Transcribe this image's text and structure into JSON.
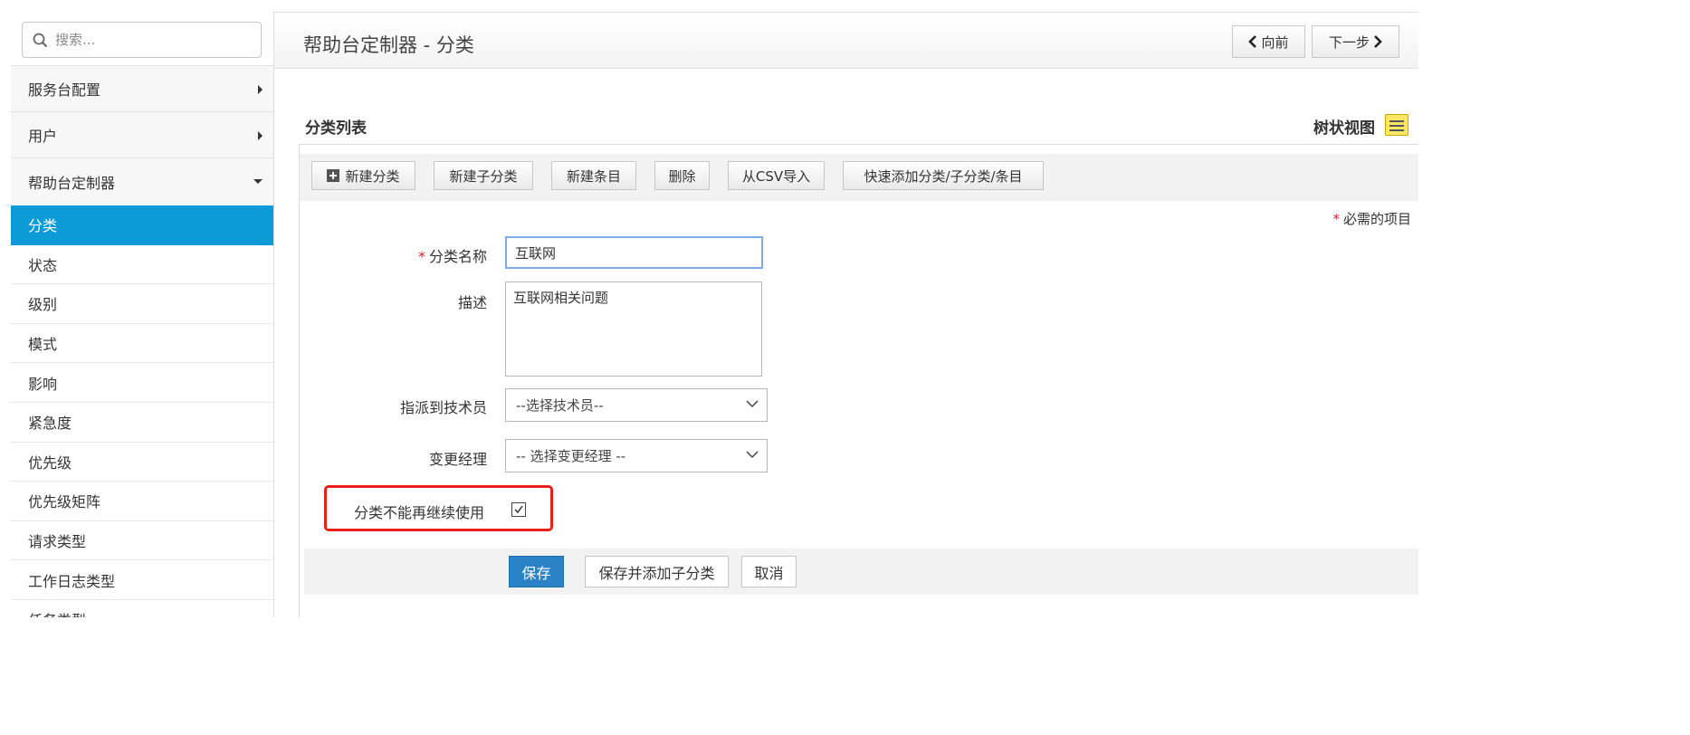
{
  "sidebar": {
    "search": {
      "placeholder": "搜索...",
      "value": ""
    },
    "groups": [
      {
        "label": "服务台配置",
        "expanded": false
      },
      {
        "label": "用户",
        "expanded": false
      },
      {
        "label": "帮助台定制器",
        "expanded": true
      }
    ],
    "items": [
      {
        "label": "分类",
        "active": true
      },
      {
        "label": "状态"
      },
      {
        "label": "级别"
      },
      {
        "label": "模式"
      },
      {
        "label": "影响"
      },
      {
        "label": "紧急度"
      },
      {
        "label": "优先级"
      },
      {
        "label": "优先级矩阵"
      },
      {
        "label": "请求类型"
      },
      {
        "label": "工作日志类型"
      },
      {
        "label": "任务类型"
      }
    ],
    "active_color": "#0d9bd8"
  },
  "header": {
    "title": "帮助台定制器 - 分类",
    "prev_label": "向前",
    "next_label": "下一步"
  },
  "section": {
    "title": "分类列表",
    "tree_view_label": "树状视图"
  },
  "toolbar": {
    "buttons": [
      {
        "label": "新建分类",
        "icon": "plus-square-icon"
      },
      {
        "label": "新建子分类"
      },
      {
        "label": "新建条目"
      },
      {
        "label": "删除"
      },
      {
        "label": "从CSV导入"
      },
      {
        "label": "快速添加分类/子分类/条目"
      }
    ]
  },
  "form": {
    "required_note": "必需的项目",
    "required_star": "*",
    "name": {
      "label": "分类名称",
      "value": "互联网",
      "required": true
    },
    "description": {
      "label": "描述",
      "value": "互联网相关问题"
    },
    "technician": {
      "label": "指派到技术员",
      "selected": "--选择技术员--"
    },
    "change_manager": {
      "label": "变更经理",
      "selected": "-- 选择变更经理 --"
    },
    "deprecated": {
      "label": "分类不能再继续使用",
      "checked": true
    },
    "highlight_color": "#e8201a"
  },
  "actions": {
    "save": "保存",
    "save_add_sub": "保存并添加子分类",
    "cancel": "取消",
    "save_color": "#2a83c6"
  }
}
